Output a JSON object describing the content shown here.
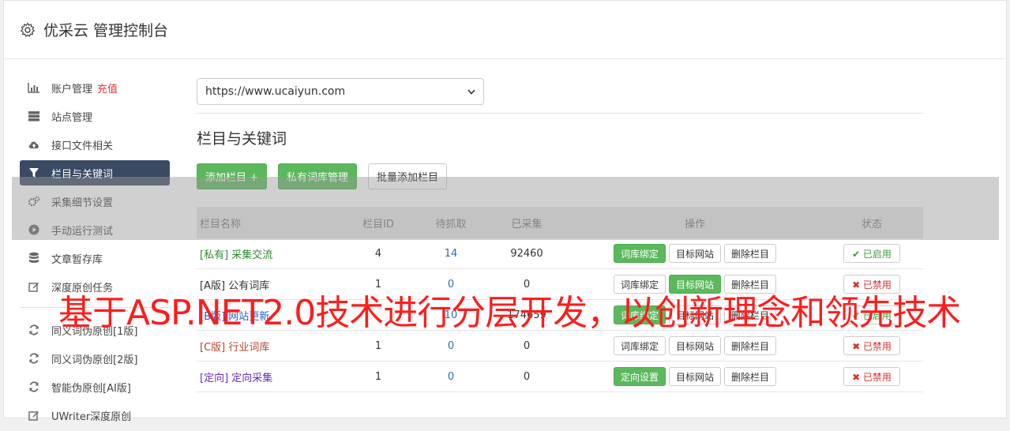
{
  "header": {
    "title": "优采云 管理控制台",
    "icon": "gear-icon"
  },
  "sidebar": {
    "items": [
      {
        "label": "账户管理",
        "extra": "充值",
        "icon": "bar-chart-icon"
      },
      {
        "label": "站点管理",
        "icon": "server-icon"
      },
      {
        "label": "接口文件相关",
        "icon": "cloud-upload-icon"
      },
      {
        "label": "栏目与关键词",
        "icon": "filter-icon",
        "active": true
      },
      {
        "label": "采集细节设置",
        "icon": "cogs-icon"
      },
      {
        "label": "手动运行测试",
        "icon": "play-circle-icon"
      },
      {
        "label": "文章暂存库",
        "icon": "database-icon"
      },
      {
        "label": "深度原创任务",
        "icon": "edit-icon"
      }
    ],
    "items2": [
      {
        "label": "同义词伪原创[1版]",
        "icon": "refresh-icon"
      },
      {
        "label": "同义词伪原创[2版]",
        "icon": "refresh-icon"
      },
      {
        "label": "智能伪原创[AI版]",
        "icon": "refresh-icon"
      },
      {
        "label": "UWriter深度原创",
        "icon": "edit-icon"
      }
    ]
  },
  "main": {
    "site_select": "https://www.ucaiyun.com",
    "section_title": "栏目与关键词",
    "buttons": {
      "add": "添加栏目 +",
      "private_lib": "私有词库管理",
      "batch_add": "批量添加栏目"
    },
    "table": {
      "headers": {
        "name": "栏目名称",
        "id": "栏目ID",
        "wait": "待抓取",
        "done": "已采集",
        "ops": "操作",
        "status": "状态"
      },
      "rows": [
        {
          "tag": "[私有]",
          "name": "采集交流",
          "id": "4",
          "wait": "14",
          "done": "92460",
          "op1": "词库绑定",
          "op2": "目标网站",
          "op3": "删除栏目",
          "status": "✔ 已启用"
        },
        {
          "tag": "[A版]",
          "name": "公有词库",
          "id": "1",
          "wait": "0",
          "done": "0",
          "op1": "词库绑定",
          "op2": "目标网站",
          "op3": "删除栏目",
          "status": "✖ 已禁用"
        },
        {
          "tag": "[B版]",
          "name": "网站更新",
          "id": "",
          "wait": "10",
          "done": "174659",
          "op1": "词库绑定",
          "op2": "目标网站",
          "op3": "删除栏目",
          "status": "✔ 已启用"
        },
        {
          "tag": "[C版]",
          "name": "行业词库",
          "id": "1",
          "wait": "0",
          "done": "0",
          "op1": "词库绑定",
          "op2": "目标网站",
          "op3": "删除栏目",
          "status": "✖ 已禁用"
        },
        {
          "tag": "[定向]",
          "name": "定向采集",
          "id": "1",
          "wait": "0",
          "done": "0",
          "op1": "定向设置",
          "op2": "目标网站",
          "op3": "删除栏目",
          "status": "✖ 已禁用"
        }
      ]
    }
  },
  "watermark": "基于ASP.NET2.0技术进行分层开发，以创新理念和领先技术",
  "colors": {
    "accent": "#5cb85c",
    "active_nav": "#3b4a63",
    "danger": "#d9302c",
    "watermark": "#ff1c1c"
  }
}
